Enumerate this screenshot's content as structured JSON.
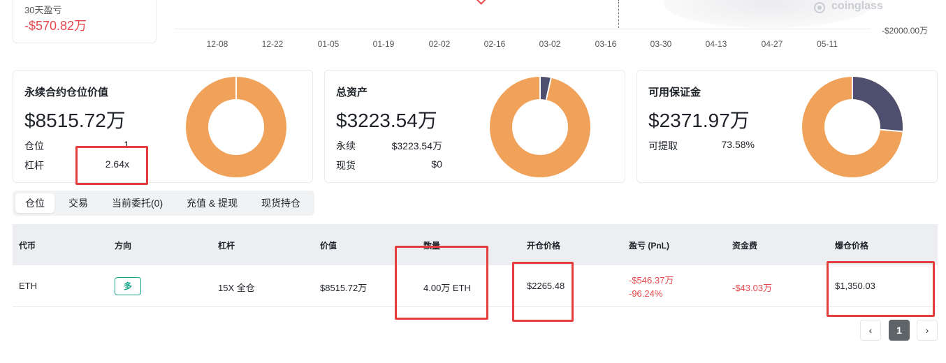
{
  "top_chart": {
    "pnl_label": "30天盈亏",
    "pnl_value": "-$570.82万",
    "x_ticks": [
      "12-08",
      "12-22",
      "01-05",
      "01-19",
      "02-02",
      "02-16",
      "03-02",
      "03-16",
      "03-30",
      "04-13",
      "04-27",
      "05-11"
    ],
    "y_neg_label": "-$2000.00万",
    "watermark": "coinglass"
  },
  "cards": {
    "perp": {
      "title": "永续合约仓位价值",
      "value": "$8515.72万",
      "rows": [
        {
          "label": "仓位",
          "value": "1"
        },
        {
          "label": "杠杆",
          "value": "2.64x"
        }
      ],
      "donut_fraction": 1.0
    },
    "assets": {
      "title": "总资产",
      "value": "$3223.54万",
      "rows": [
        {
          "label": "永续",
          "value": "$3223.54万"
        },
        {
          "label": "现货",
          "value": "$0"
        }
      ],
      "donut_fraction": 0.965
    },
    "margin": {
      "title": "可用保证金",
      "value": "$2371.97万",
      "rows": [
        {
          "label": "可提取",
          "value": "73.58%"
        }
      ],
      "donut_fraction": 0.7358
    }
  },
  "tabs": [
    "仓位",
    "交易",
    "当前委托(0)",
    "充值 & 提现",
    "现货持仓"
  ],
  "table": {
    "headers": [
      "代币",
      "方向",
      "杠杆",
      "价值",
      "数量",
      "开仓价格",
      "盈亏 (PnL)",
      "资金费",
      "爆仓价格"
    ],
    "row": {
      "token": "ETH",
      "direction": "多",
      "leverage": "15X 全仓",
      "value": "$8515.72万",
      "amount": "4.00万 ETH",
      "entry_price": "$2265.48",
      "pnl": "-$546.37万",
      "pnl_pct": "-96.24%",
      "funding": "-$43.03万",
      "liq_price": "$1,350.03"
    }
  },
  "pagination": {
    "prev": "‹",
    "page": "1",
    "next": "›"
  },
  "colors": {
    "orange": "#f0a25a",
    "navy": "#4e4f6e",
    "red": "#e5484d",
    "green": "#18a58a",
    "highlight": "#e43d3d"
  }
}
